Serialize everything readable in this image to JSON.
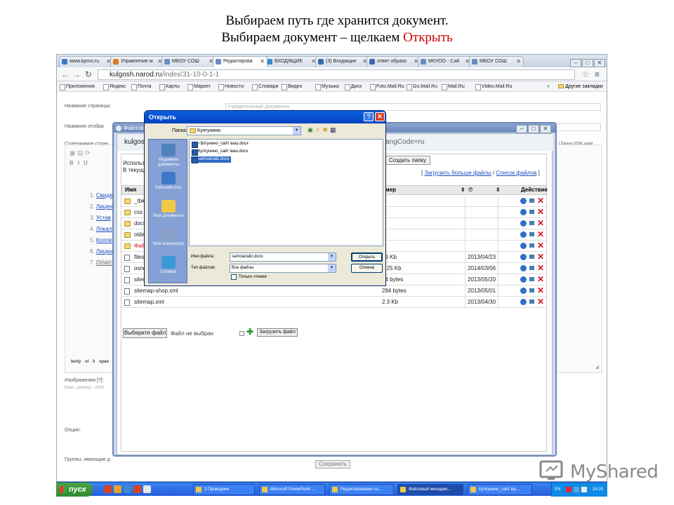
{
  "slide": {
    "line1": "Выбираем путь где хранится документ.",
    "line2_prefix": "Выбираем документ – щелкаем ",
    "line2_highlight": "Открыть"
  },
  "browser": {
    "tabs": [
      {
        "label": "www.kpmo.ru",
        "color": "#3a7ac0"
      },
      {
        "label": "Управление м",
        "color": "#e07a20"
      },
      {
        "label": "МБОУ СОШ",
        "color": "#6a8cbf"
      },
      {
        "label": "Редактирова",
        "color": "#6a8cbf",
        "active": true
      },
      {
        "label": "ВХОДЯЩИЕ",
        "color": "#3a8ad0"
      },
      {
        "label": "(3) Входящие",
        "color": "#3a6ab0"
      },
      {
        "label": "ответ образо",
        "color": "#3a6ab0"
      },
      {
        "label": "МКУОО - Сай",
        "color": "#6a8cbf"
      },
      {
        "label": "МБОУ СОШ",
        "color": "#6a8cbf"
      }
    ],
    "url_host": "kulgosh.narod.ru",
    "url_path": "/index/31-10-0-1-1",
    "bookmarks": [
      "Приложения",
      "Яндекс",
      "Почта",
      "Карты",
      "Маркет",
      "Новости",
      "Словари",
      "Видео",
      "Музыка",
      "Диск",
      "Foto.Mail.Ru",
      "Go.Mail.Ru",
      "Mail.Ru",
      "Video.Mail.Ru"
    ],
    "bookmarks_more": "»",
    "bookmarks_other": "Другие закладки",
    "win_min": "–",
    "win_max": "□",
    "win_close": "✕"
  },
  "editor_page": {
    "page_name_label": "Название страницы:",
    "page_name_value": "Учредительные документы",
    "display_name_label": "Название отобра",
    "content_label": "Содержимое стран",
    "html_mode": "[ Панель HTML кодa]",
    "list": [
      "Свидет",
      "Лиценз",
      "Устав",
      "Локаль",
      "Коллек",
      "Лиценз",
      "Отчет о"
    ],
    "status_path": "body  ol  li  span",
    "images_label": "Изображения [?]:",
    "images_hint": "Макс. размер - 2000",
    "options_label": "Опции:",
    "groups_label": "Группы, имеющие д",
    "save_label": "Сохранить"
  },
  "file_manager": {
    "title": "Файловы",
    "url_left": "kulgos",
    "url_right": "langCode=ru",
    "using_text": "Использ",
    "current_text": "В текуще",
    "create_folder": "Создать папку",
    "upload_more": "Загрузить больше файлы",
    "file_list_link": "Список файлов",
    "col_name": "Имя",
    "col_size": "змер",
    "col_action": "Действие",
    "rows": [
      {
        "name": "_tbk",
        "size": "",
        "date": "",
        "type": "folder"
      },
      {
        "name": "css",
        "size": "",
        "date": "",
        "type": "folder"
      },
      {
        "name": "docs",
        "size": "",
        "date": "",
        "type": "folder"
      },
      {
        "name": "olde",
        "size": "",
        "date": "",
        "type": "folder"
      },
      {
        "name": "Файл",
        "size": "",
        "date": "",
        "type": "folder"
      },
      {
        "name": "filesli",
        "size": "99 Kb",
        "date": "2013/04/23",
        "type": "file"
      },
      {
        "name": "osnc",
        "size": "6.25 Kb",
        "date": "2014/03/06",
        "type": "file"
      },
      {
        "name": "siten",
        "size": "84 bytes",
        "date": "2013/05/20",
        "type": "file"
      },
      {
        "name": "sitemap-shop.xml",
        "size": "284 bytes",
        "date": "2013/05/01",
        "type": "file"
      },
      {
        "name": "sitemap.xml",
        "size": "2.3 Kb",
        "date": "2013/04/30",
        "type": "file"
      }
    ],
    "choose_file": "Выберите файл",
    "no_file": "Файл не выбран",
    "upload_file": "Загрузить файл"
  },
  "open_dialog": {
    "title": "Открыть",
    "help": "?",
    "close": "✕",
    "folder_label": "Папка:",
    "folder_value": "Кулгунино",
    "places": [
      {
        "label": "Недавние документы",
        "color": "#4f81bd"
      },
      {
        "label": "Рабочий стол",
        "color": "#3f78c8"
      },
      {
        "label": "Мои документы",
        "color": "#f0c848"
      },
      {
        "label": "Мой компьютер",
        "color": "#8aa0c8"
      },
      {
        "label": "Сетевое",
        "color": "#3a9ad8"
      }
    ],
    "files": [
      {
        "name": "~$лгунино_сайт ваш.docx",
        "selected": false
      },
      {
        "name": "Кулгунино_сайт ваш.docx",
        "selected": false
      },
      {
        "name": "samoanaliz.docx",
        "selected": true
      }
    ],
    "filename_label": "Имя файла:",
    "filename_value": "samoanaliz.docx",
    "filetype_label": "Тип файлов:",
    "filetype_value": "Все файлы",
    "readonly_label": "Только чтение",
    "open_button": "Открыть",
    "cancel_button": "Отмена"
  },
  "taskbar": {
    "start": "пуск",
    "quicklaunch_colors": [
      "#d84224",
      "#e8a030",
      "#3a8ad0",
      "#d84224",
      "#e8e8e8"
    ],
    "tasks": [
      {
        "label": "2 Проводник",
        "active": false
      },
      {
        "label": "Microsoft PowerPoint ...",
        "active": false
      },
      {
        "label": "Редактирование со...",
        "active": false
      },
      {
        "label": "Файловый менедже...",
        "active": true
      },
      {
        "label": "Кулгунино_сайт ва...",
        "active": false
      }
    ],
    "lang": "EN",
    "time": "16:20"
  },
  "watermark": "MyShared"
}
